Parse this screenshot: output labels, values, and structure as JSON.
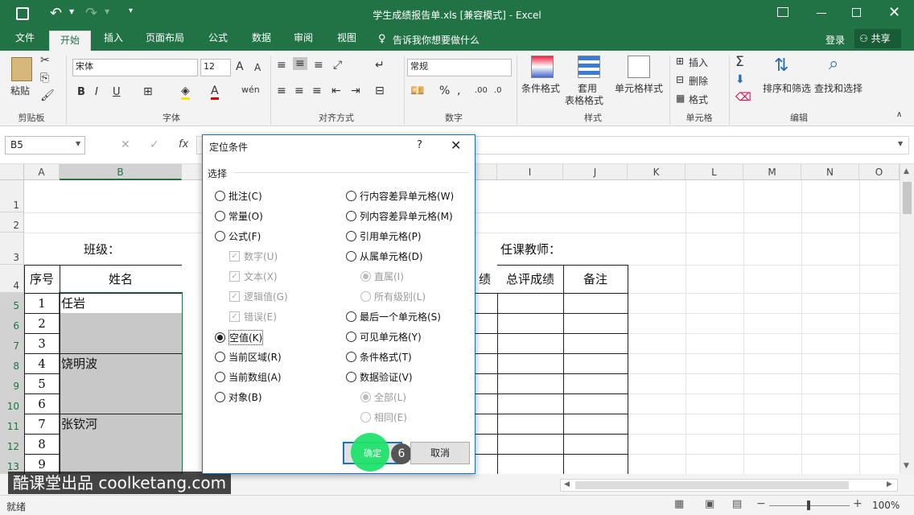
{
  "title": "学生成绩报告单.xls  [兼容模式] - Excel",
  "tabs": [
    "文件",
    "开始",
    "插入",
    "页面布局",
    "公式",
    "数据",
    "审阅",
    "视图"
  ],
  "tell_me": "告诉我你想要做什么",
  "login": "登录",
  "share": "共享",
  "ribbon": {
    "paste": "粘贴",
    "clipboard": "剪贴板",
    "font_name": "宋体",
    "font_size": "12",
    "font_group": "字体",
    "align_group": "对齐方式",
    "number_format": "常规",
    "number_group": "数字",
    "cond_format": "条件格式",
    "table_format_1": "套用",
    "table_format_2": "表格格式",
    "cell_style": "单元格样式",
    "style_group": "样式",
    "insert": "插入",
    "delete": "删除",
    "format": "格式",
    "cells_group": "单元格",
    "sort_filter": "排序和筛选",
    "find_select": "查找和选择",
    "edit_group": "编辑",
    "bold": "B",
    "italic": "I",
    "underline": "U",
    "percent": "%",
    "sigma": "Σ",
    "font_color": "A"
  },
  "namebox": "B5",
  "fx": "fx",
  "columns": [
    "A",
    "B",
    "",
    "",
    "",
    "",
    "",
    "",
    "I",
    "J",
    "K",
    "L",
    "M",
    "N",
    "O"
  ],
  "rows": [
    "1",
    "2",
    "3",
    "4",
    "5",
    "6",
    "7",
    "8",
    "9",
    "10",
    "11",
    "12",
    "13"
  ],
  "sheet": {
    "class_label": "班级：",
    "teacher_label": "任课教师：",
    "h_seq": "序号",
    "h_name": "姓名",
    "h_partial": "绩",
    "h_total": "总评成绩",
    "h_remark": "备注",
    "seq": [
      "1",
      "2",
      "3",
      "4",
      "5",
      "6",
      "7",
      "8",
      "9"
    ],
    "names": [
      "任岩",
      "",
      "",
      "饶明波",
      "",
      "",
      "张钦河",
      "",
      ""
    ]
  },
  "dialog": {
    "title": "定位条件",
    "help": "?",
    "section": "选择",
    "left_options": [
      "批注(C)",
      "常量(O)",
      "公式(F)",
      "数字(U)",
      "文本(X)",
      "逻辑值(G)",
      "错误(E)",
      "空值(K)",
      "当前区域(R)",
      "当前数组(A)",
      "对象(B)"
    ],
    "right_options": [
      "行内容差异单元格(W)",
      "列内容差异单元格(M)",
      "引用单元格(P)",
      "从属单元格(D)",
      "直属(I)",
      "所有级别(L)",
      "最后一个单元格(S)",
      "可见单元格(Y)",
      "条件格式(T)",
      "数据验证(V)",
      "全部(L)",
      "相同(E)"
    ],
    "ok": "确定",
    "cancel": "取消",
    "step": "6"
  },
  "watermark": "酷课堂出品 coolketang.com",
  "status": "就绪",
  "zoom": "100%",
  "colors": {
    "excel_green": "#217346",
    "selection_gray": "#c8c8c8",
    "highlight": "#1fe26a"
  }
}
